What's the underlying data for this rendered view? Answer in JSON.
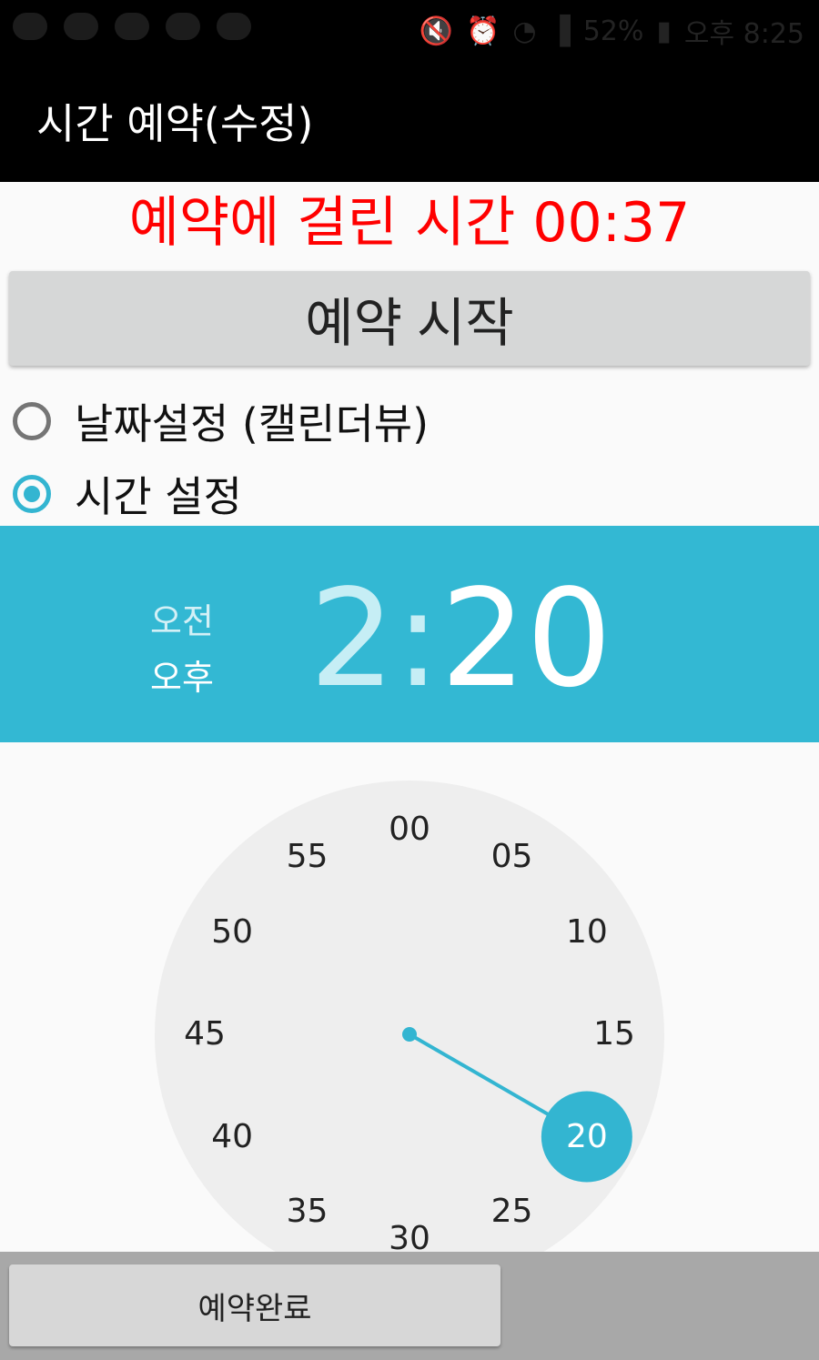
{
  "status_bar": {
    "battery": "52%",
    "time": "오후 8:25"
  },
  "app_bar": {
    "title": "시간 예약(수정)"
  },
  "elapsed_label": "예약에 걸린 시간 00:37",
  "start_button_label": "예약 시작",
  "radio_options": [
    {
      "label": "날짜설정 (캘린더뷰)",
      "checked": false
    },
    {
      "label": "시간 설정",
      "checked": true
    }
  ],
  "time_picker": {
    "am_label": "오전",
    "pm_label": "오후",
    "hour": "2",
    "separator": ":",
    "minute": "20",
    "selected_minute": "20",
    "dial_labels": [
      "00",
      "05",
      "10",
      "15",
      "20",
      "25",
      "30",
      "35",
      "40",
      "45",
      "50",
      "55"
    ],
    "accent_color": "#33b5d1"
  },
  "done_button_label": "예약완료"
}
